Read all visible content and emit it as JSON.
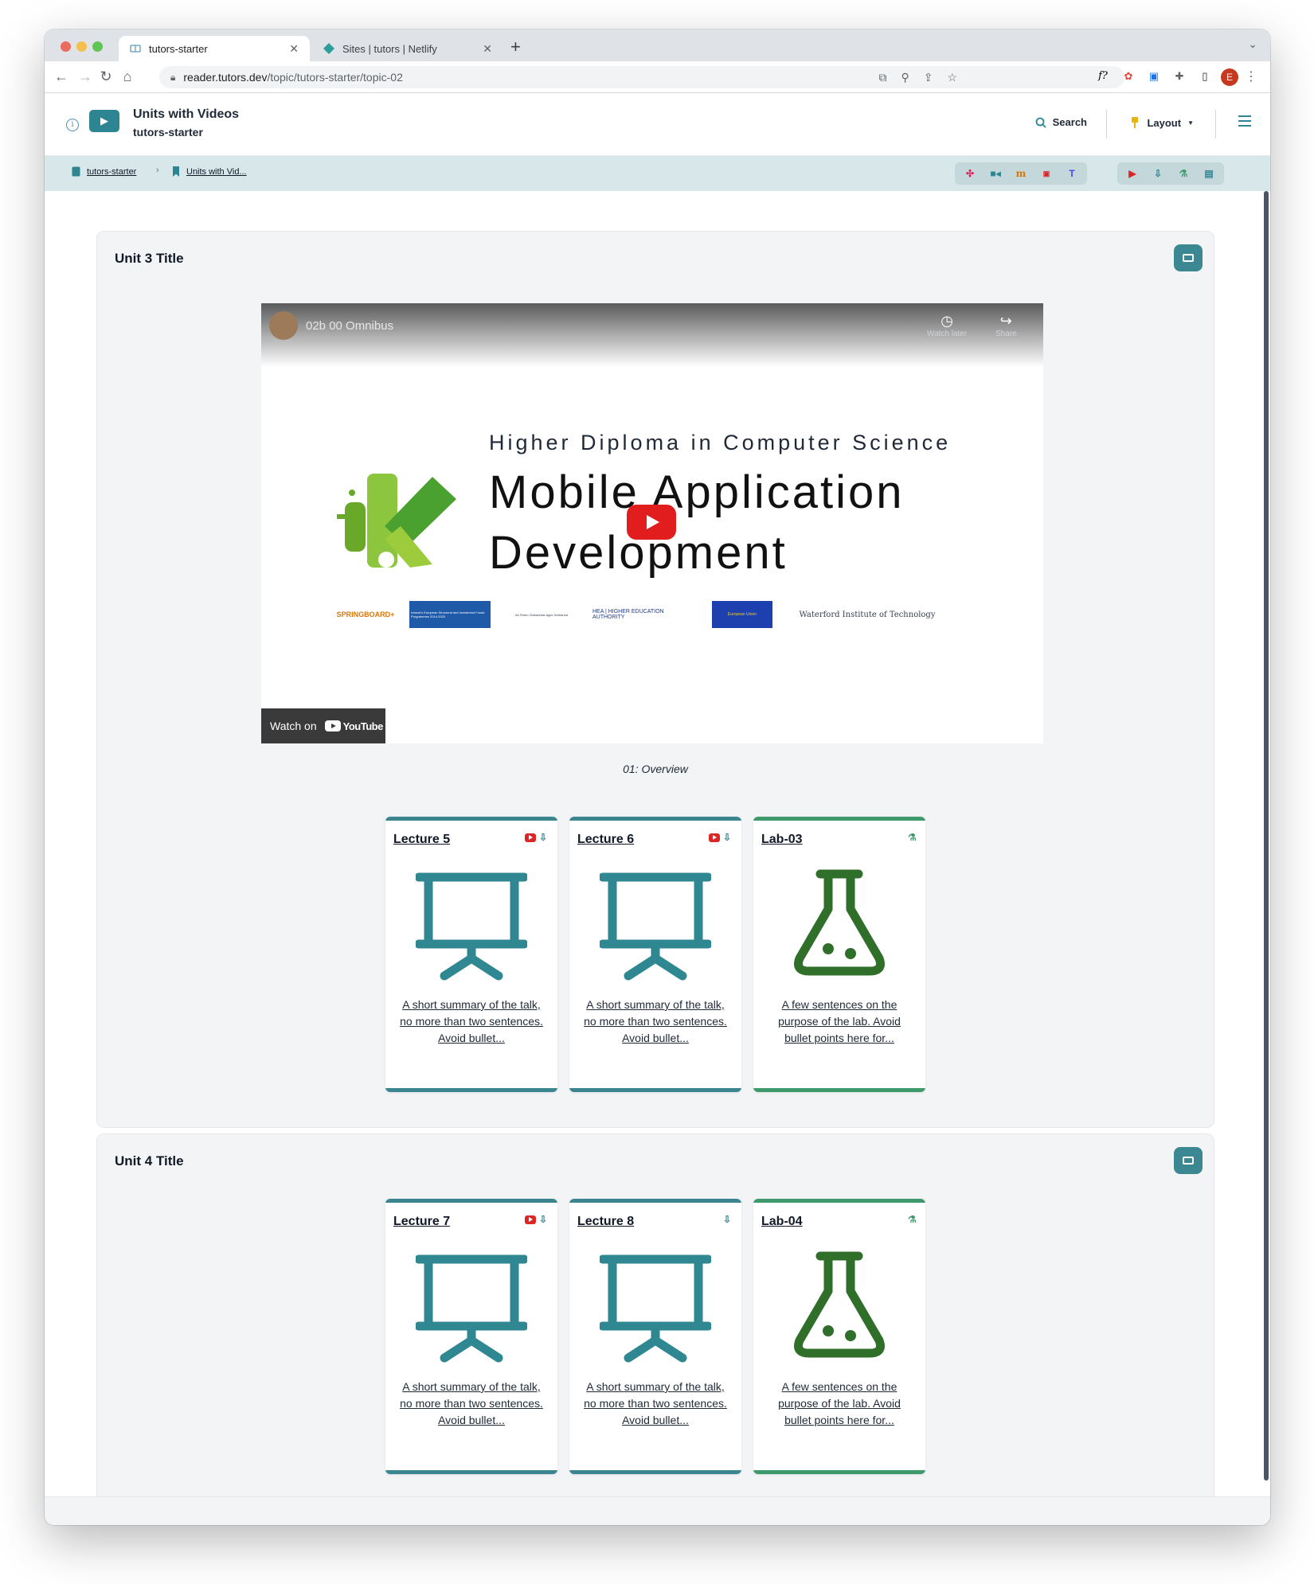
{
  "browser": {
    "tabs": [
      {
        "title": "tutors-starter",
        "active": true
      },
      {
        "title": "Sites | tutors | Netlify",
        "active": false
      }
    ],
    "url_host": "reader.tutors.dev",
    "url_path": "/topic/tutors-starter/topic-02",
    "profile_initial": "E"
  },
  "header": {
    "title": "Units with Videos",
    "subtitle": "tutors-starter",
    "search_label": "Search",
    "layout_label": "Layout"
  },
  "breadcrumbs": [
    {
      "label": "tutors-starter",
      "icon": "book-icon"
    },
    {
      "label": "Units with Vid...",
      "icon": "bookmark-icon"
    }
  ],
  "units": [
    {
      "title": "Unit 3 Title",
      "video": {
        "channel_title": "02b 00 Omnibus",
        "watch_later_label": "Watch later",
        "share_label": "Share",
        "slide_subtitle": "Higher Diploma in Computer Science",
        "slide_title_line1": "Mobile Application",
        "slide_title_line2": "Development",
        "watch_on_label": "Watch on",
        "youtube_label": "YouTube",
        "sponsors": [
          "SPRINGBOARD+",
          "Ireland's European Structural and Investment Funds Programmes 2014-2020",
          "An Roinn Oideachais agus Scileanna",
          "HEA | HIGHER EDUCATION AUTHORITY",
          "European Union",
          "Waterford Institute of Technology"
        ],
        "caption": "01: Overview"
      },
      "cards": [
        {
          "title": "Lecture 5",
          "kind": "talk",
          "badges": [
            "youtube-icon",
            "download-icon"
          ],
          "summary": "A short summary of the talk, no more than two sentences. Avoid bullet..."
        },
        {
          "title": "Lecture 6",
          "kind": "talk",
          "badges": [
            "youtube-icon",
            "download-icon"
          ],
          "summary": "A short summary of the talk, no more than two sentences. Avoid bullet..."
        },
        {
          "title": "Lab-03",
          "kind": "lab",
          "badges": [
            "lab-icon"
          ],
          "summary": "A few sentences on the purpose of the lab. Avoid bullet points here for..."
        }
      ]
    },
    {
      "title": "Unit 4 Title",
      "cards": [
        {
          "title": "Lecture 7",
          "kind": "talk",
          "badges": [
            "youtube-icon",
            "download-icon"
          ],
          "summary": "A short summary of the talk, no more than two sentences. Avoid bullet..."
        },
        {
          "title": "Lecture 8",
          "kind": "talk",
          "badges": [
            "download-icon"
          ],
          "summary": "A short summary of the talk, no more than two sentences. Avoid bullet..."
        },
        {
          "title": "Lab-04",
          "kind": "lab",
          "badges": [
            "lab-icon"
          ],
          "summary": "A few sentences on the purpose of the lab. Avoid bullet points here for..."
        }
      ]
    }
  ],
  "colors": {
    "primary_teal": "#2d8592",
    "lab_green": "#2f6f2a",
    "talk_border": "#3b8590",
    "lab_border": "#3e9a6b"
  }
}
